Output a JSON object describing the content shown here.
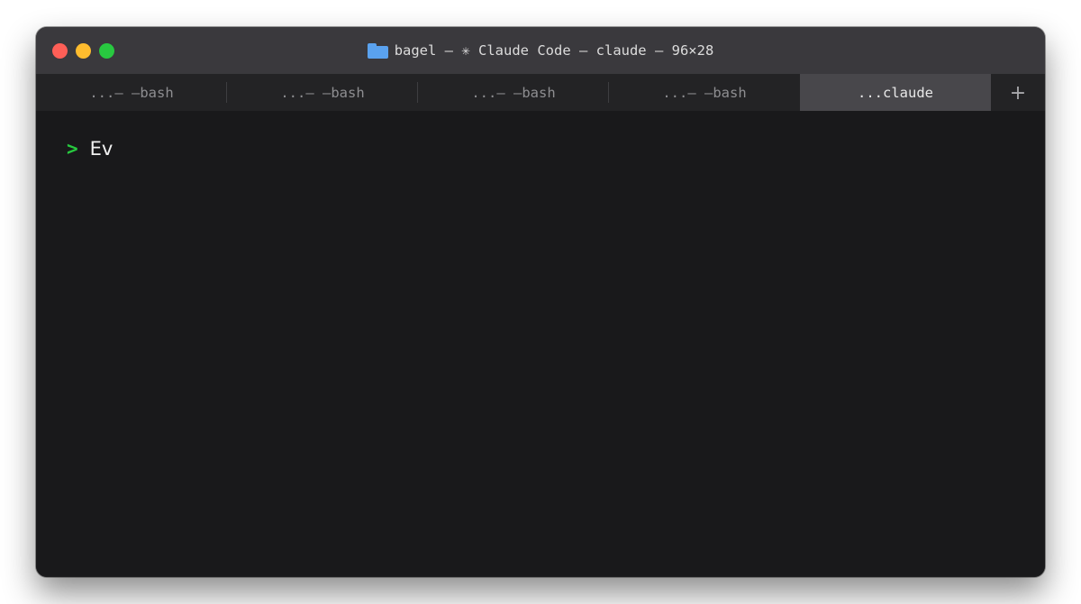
{
  "window": {
    "title": "bagel — ✳ Claude Code — claude — 96×28",
    "controls": {
      "close_color": "#fe5f57",
      "minimize_color": "#febc2e",
      "zoom_color": "#28c840"
    },
    "title_icon": "folder-icon"
  },
  "tabs": [
    {
      "label": "...— —bash",
      "active": false
    },
    {
      "label": "...— —bash",
      "active": false
    },
    {
      "label": "...— —bash",
      "active": false
    },
    {
      "label": "...— —bash",
      "active": false
    },
    {
      "label": "...claude",
      "active": true
    }
  ],
  "new_tab_label": "+",
  "terminal": {
    "prompt_symbol": ">",
    "prompt_color": "#27c93f",
    "input": "Ev"
  }
}
